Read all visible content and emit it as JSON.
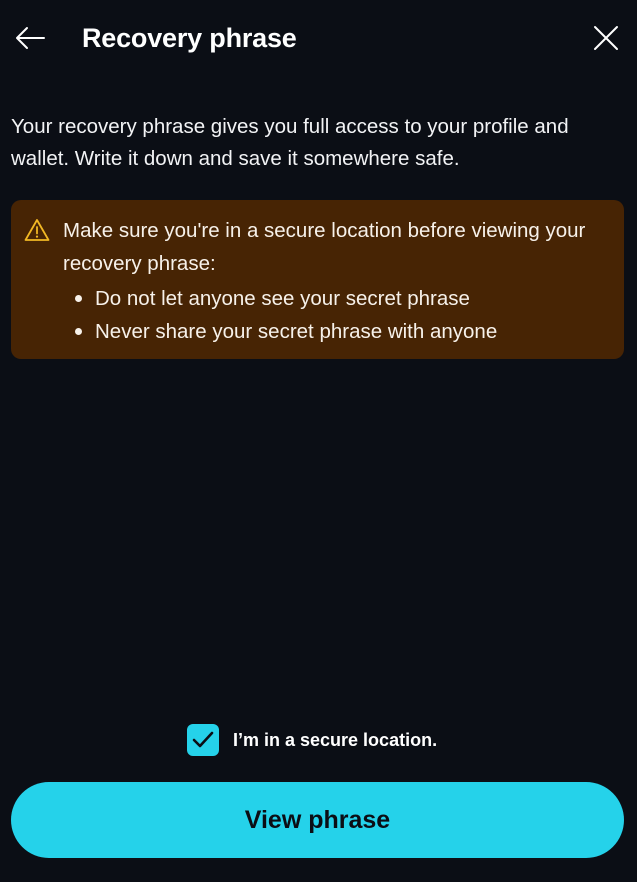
{
  "header": {
    "title": "Recovery phrase",
    "back_icon": "arrow-left-icon",
    "close_icon": "close-icon"
  },
  "intro": {
    "text": "Your recovery phrase gives you full access to your profile and wallet. Write it down and save it somewhere safe."
  },
  "warning": {
    "icon": "warning-triangle-icon",
    "heading": "Make sure you're in a secure location before viewing your recovery phrase:",
    "items": [
      "Do not let anyone see your secret phrase",
      "Never share your secret phrase with anyone"
    ]
  },
  "confirm": {
    "checked": true,
    "label": "I’m in a secure location."
  },
  "actions": {
    "primary_label": "View phrase"
  },
  "colors": {
    "background": "#0b0e15",
    "accent": "#25d2ea",
    "warning_bg": "#472404",
    "warning_icon": "#f2b824"
  }
}
